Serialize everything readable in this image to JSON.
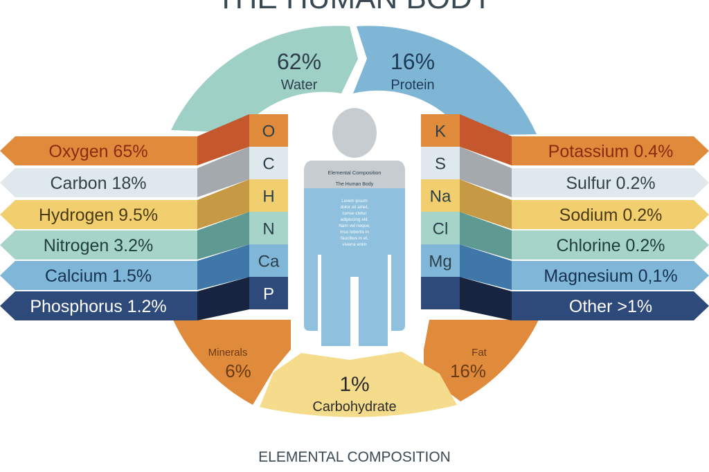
{
  "title": "THE HUMAN BODY",
  "footer": "ELEMENTAL COMPOSITION",
  "colors": {
    "teal": "#9fd0c6",
    "blue": "#7fb6d6",
    "orange": "#e08a3c",
    "yellow": "#f2d77a",
    "body_gray": "#c7ccd0",
    "body_blue": "#8fc0de"
  },
  "segments": {
    "water": {
      "value": "62%",
      "label": "Water"
    },
    "protein": {
      "value": "16%",
      "label": "Protein"
    },
    "minerals": {
      "value": "6%",
      "label": "Minerals"
    },
    "fat": {
      "value": "16%",
      "label": "Fat"
    },
    "carbohydrate": {
      "value": "1%",
      "label": "Carbohydrate"
    }
  },
  "left_elements": [
    {
      "symbol": "O",
      "label": "Oxygen 65%",
      "color": "#e08a3c",
      "dark": "#c4572b",
      "text": "#8a2a10"
    },
    {
      "symbol": "C",
      "label": "Carbon 18%",
      "color": "#dfe8ec",
      "dark": "#a3a9ad",
      "text": "#333f48"
    },
    {
      "symbol": "H",
      "label": "Hydrogen 9.5%",
      "color": "#f2cf6e",
      "dark": "#c69a44",
      "text": "#4a3a10"
    },
    {
      "symbol": "N",
      "label": "Nitrogen 3.2%",
      "color": "#a7d4c8",
      "dark": "#5f9a92",
      "text": "#1f3d3a"
    },
    {
      "symbol": "Ca",
      "label": "Calcium 1.5%",
      "color": "#80b7d8",
      "dark": "#3f78a8",
      "text": "#14324e"
    },
    {
      "symbol": "P",
      "label": "Phosphorus 1.2%",
      "color": "#2e4a7a",
      "dark": "#162440",
      "text": "#ffffff"
    }
  ],
  "right_elements": [
    {
      "symbol": "K",
      "label": "Potassium 0.4%",
      "color": "#e08a3c",
      "dark": "#c4572b",
      "text": "#8a2a10"
    },
    {
      "symbol": "S",
      "label": "Sulfur 0.2%",
      "color": "#dfe8ec",
      "dark": "#a3a9ad",
      "text": "#333f48"
    },
    {
      "symbol": "Na",
      "label": "Sodium 0.2%",
      "color": "#f2cf6e",
      "dark": "#c69a44",
      "text": "#4a3a10"
    },
    {
      "symbol": "Cl",
      "label": "Chlorine 0.2%",
      "color": "#a7d4c8",
      "dark": "#5f9a92",
      "text": "#1f3d3a"
    },
    {
      "symbol": "Mg",
      "label": "Magnesium 0,1%",
      "color": "#80b7d8",
      "dark": "#3f78a8",
      "text": "#14324e"
    },
    {
      "symbol": "",
      "label": "Other >1%",
      "color": "#2e4a7a",
      "dark": "#162440",
      "text": "#ffffff"
    }
  ],
  "figure": {
    "heading": "Elemental Composition",
    "subheading": "The Human Body",
    "body_text": [
      "Lorem ipsum",
      "dolor sit amet,",
      "conse ctetur",
      "adipiscing elit.",
      "Nam vel neque,",
      "mus lobortis in",
      "faucibus in et,",
      "viverra enim"
    ]
  }
}
